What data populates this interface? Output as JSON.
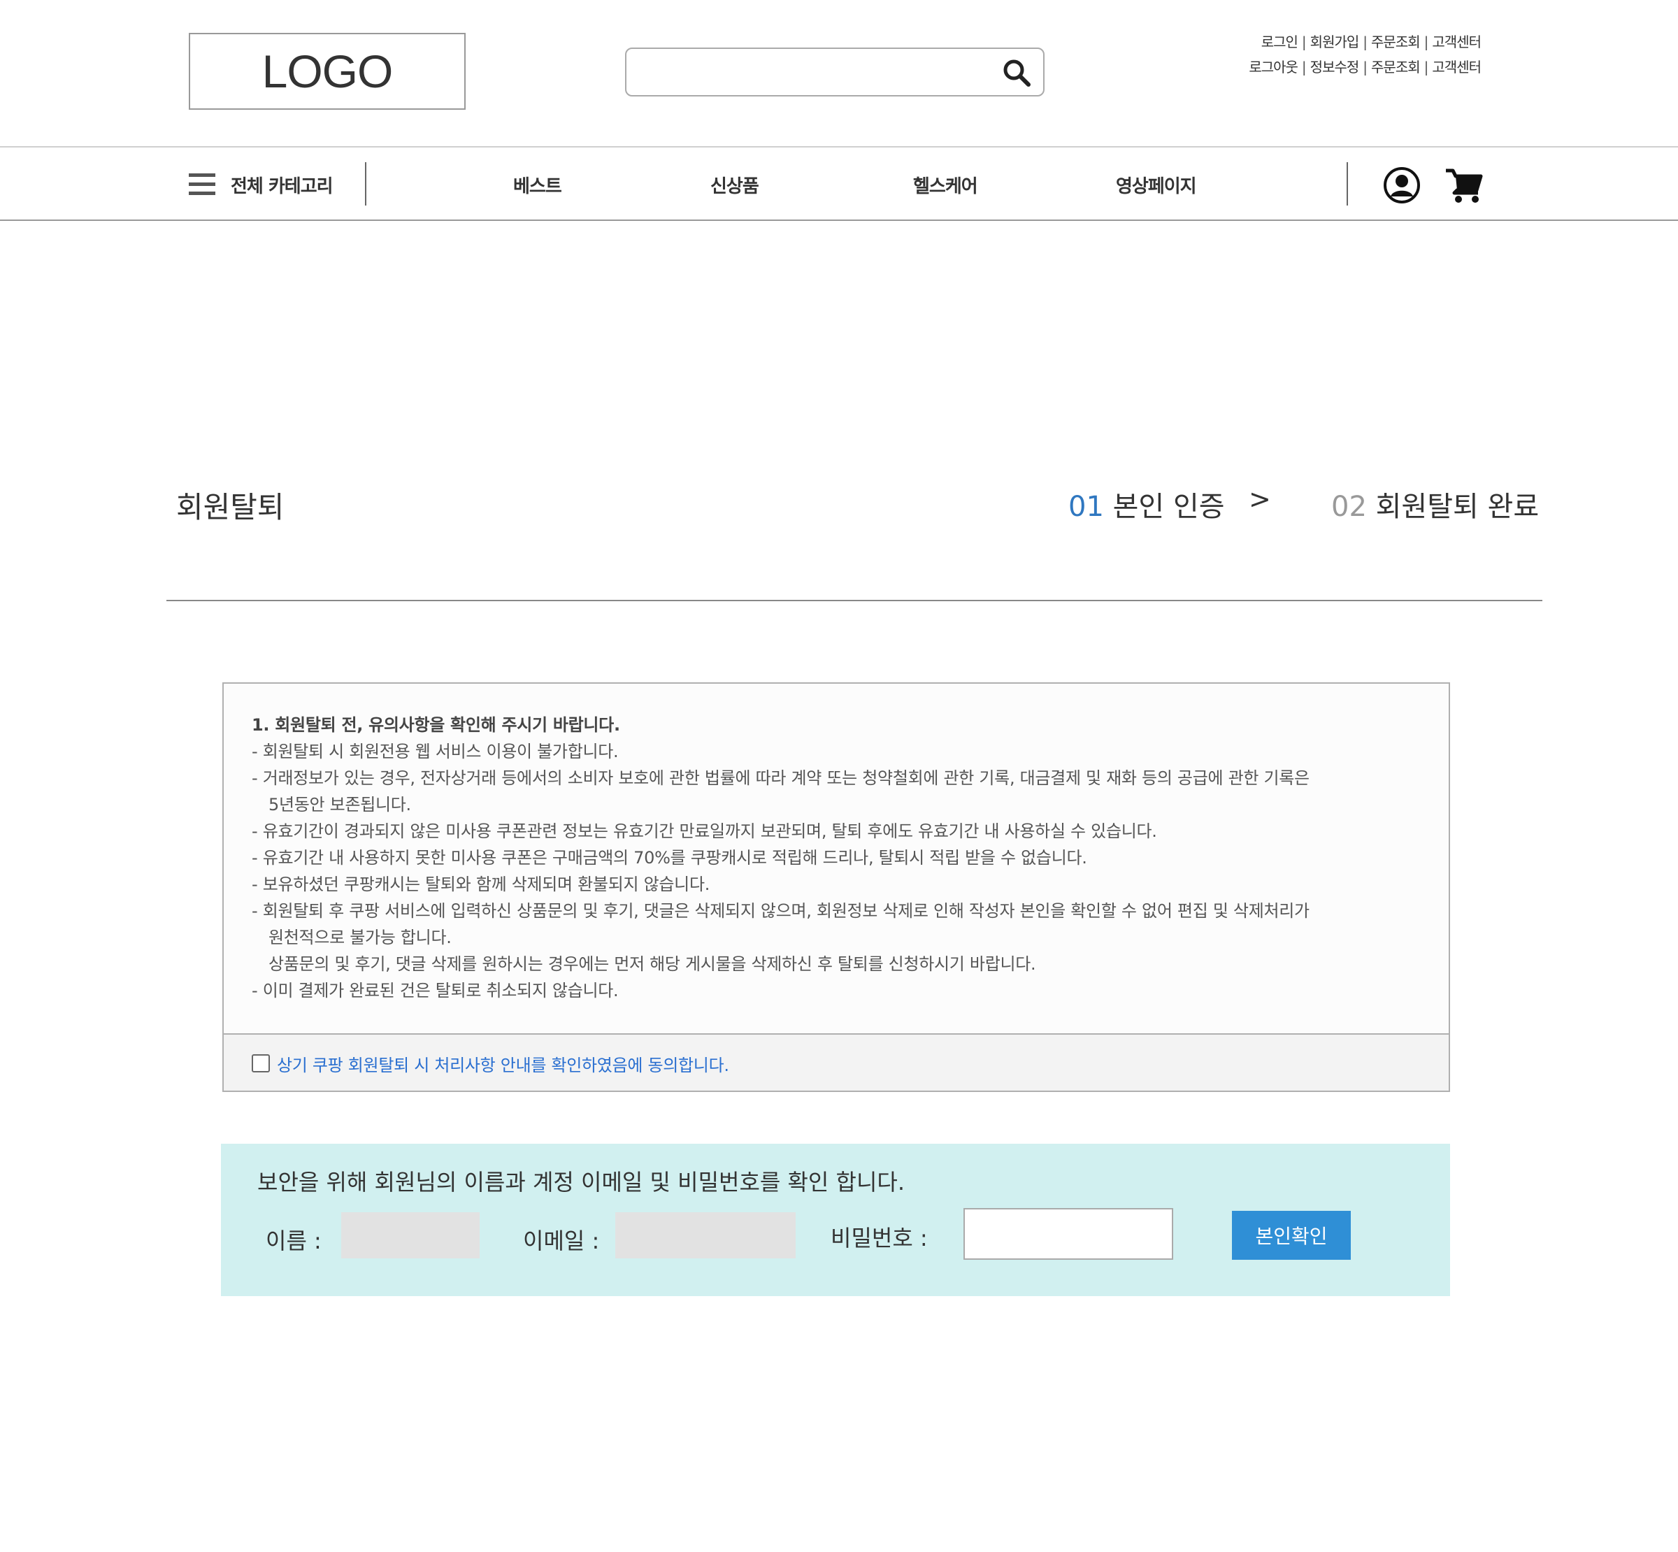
{
  "header": {
    "logo_text": "LOGO",
    "search": {
      "placeholder": "",
      "value": ""
    },
    "util_links_row1": [
      "로그인",
      "회원가입",
      "주문조회",
      "고객센터"
    ],
    "util_links_row2": [
      "로그아웃",
      "정보수정",
      "주문조회",
      "고객센터"
    ],
    "separator": "|"
  },
  "nav": {
    "all_category": "전체 카테고리",
    "items": [
      "베스트",
      "신상품",
      "헬스케어",
      "영상페이지"
    ],
    "icons": [
      "menu-icon",
      "user-icon",
      "cart-icon"
    ]
  },
  "page": {
    "title": "회원탈퇴",
    "steps": [
      {
        "num": "01",
        "label": "본인 인증"
      },
      {
        "num": "02",
        "label": "회원탈퇴 완료"
      }
    ],
    "step_arrow": ">"
  },
  "notice": {
    "heading": "1. 회원탈퇴 전, 유의사항을 확인해 주시기 바랍니다.",
    "lines": [
      "- 회원탈퇴 시 회원전용 웹 서비스 이용이 불가합니다.",
      "- 거래정보가 있는 경우, 전자상거래 등에서의 소비자 보호에 관한 법률에 따라 계약 또는 청약철회에 관한 기록, 대금결제 및 재화 등의 공급에 관한 기록은",
      "5년동안 보존됩니다.",
      "- 유효기간이 경과되지 않은 미사용 쿠폰관련 정보는 유효기간 만료일까지 보관되며, 탈퇴 후에도 유효기간 내 사용하실 수 있습니다.",
      "- 유효기간 내 사용하지 못한 미사용 쿠폰은 구매금액의 70%를 쿠팡캐시로 적립해 드리나, 탈퇴시 적립 받을 수 없습니다.",
      "- 보유하셨던 쿠팡캐시는 탈퇴와 함께 삭제되며 환불되지 않습니다.",
      "- 회원탈퇴 후 쿠팡 서비스에 입력하신 상품문의 및 후기, 댓글은 삭제되지 않으며, 회원정보 삭제로 인해 작성자 본인을 확인할 수 없어 편집 및 삭제처리가",
      "원천적으로 불가능 합니다.",
      "상품문의 및 후기, 댓글 삭제를 원하시는 경우에는 먼저 해당 게시물을 삭제하신 후 탈퇴를 신청하시기 바랍니다.",
      "- 이미 결제가 완료된 건은 탈퇴로 취소되지 않습니다."
    ],
    "agree_label": "상기 쿠팡 회원탈퇴 시 처리사항 안내를 확인하였음에 동의합니다.",
    "agree_checked": false
  },
  "verify": {
    "message": "보안을 위해 회원님의 이름과 계정 이메일 및 비밀번호를 확인 합니다.",
    "name_label": "이름 :",
    "name_value": "",
    "email_label": "이메일 :",
    "email_value": "",
    "password_label": "비밀번호 :",
    "password_value": "",
    "confirm_button": "본인확인"
  },
  "colors": {
    "accent": "#2f8fd6",
    "step_active": "#2f77c0",
    "step_inactive": "#999999",
    "agree_text": "#2a6fd0",
    "verify_bg": "#d1f0f0"
  }
}
